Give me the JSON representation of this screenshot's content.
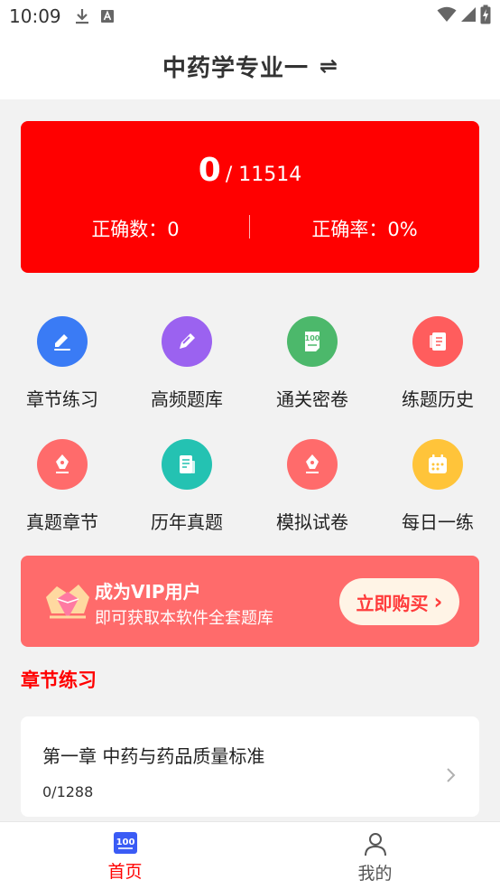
{
  "status_bar": {
    "time": "10:09"
  },
  "header": {
    "title": "中药学专业一",
    "switch_icon": "⇌"
  },
  "stats": {
    "done": "0",
    "separator": "/",
    "total": "11514",
    "correct_count_label": "正确数：0",
    "accuracy_label": "正确率：0%"
  },
  "features": [
    {
      "label": "章节练习",
      "icon": "edit-icon",
      "color": "#3a7bf5"
    },
    {
      "label": "高频题库",
      "icon": "pencil-icon",
      "color": "#9b62f0"
    },
    {
      "label": "通关密卷",
      "icon": "paper-100-icon",
      "color": "#4cb86b"
    },
    {
      "label": "练题历史",
      "icon": "notebook-icon",
      "color": "#ff5d5d"
    },
    {
      "label": "真题章节",
      "icon": "pen-nib-icon",
      "color": "#ff6b6b"
    },
    {
      "label": "历年真题",
      "icon": "document-icon",
      "color": "#24c2b2"
    },
    {
      "label": "模拟试卷",
      "icon": "pen-nib-icon",
      "color": "#ff6b6b"
    },
    {
      "label": "每日一练",
      "icon": "calendar-icon",
      "color": "#ffc43a"
    }
  ],
  "vip": {
    "title": "成为VIP用户",
    "subtitle": "即可获取本软件全套题库",
    "button": "立即购买",
    "button_chevron": "›"
  },
  "section": {
    "title": "章节练习"
  },
  "chapters": [
    {
      "title": "第一章 中药与药品质量标准",
      "progress": "0/1288"
    }
  ],
  "tabbar": {
    "home": "首页",
    "home_icon_text": "100",
    "mine": "我的"
  }
}
